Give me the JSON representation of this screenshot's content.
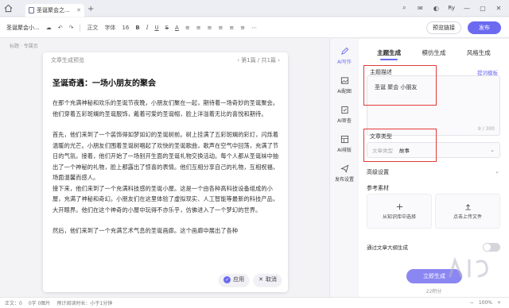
{
  "titlebar": {
    "tab_title": "圣诞聚会之...",
    "user_initials": "Ry",
    "controls": [
      "—",
      "▢",
      "✕"
    ]
  },
  "toolbar": {
    "doc_name": "圣诞聚会小...",
    "items": [
      "正文",
      "字体",
      "16",
      "B",
      "I",
      "U",
      "S",
      "A",
      "≡",
      "≡",
      "≡",
      "≡",
      "≡",
      "≡",
      "⋯"
    ],
    "preview_label": "预览链接",
    "publish_label": "发布"
  },
  "breadcrumb": "标题  · 专属页",
  "card": {
    "header": "文章生成预览",
    "pager": "‹ 第1篇 / 共1篇 ›",
    "title": "圣诞奇遇：一场小朋友的聚会",
    "paragraphs": [
      "在那个充满神秘和欢乐的圣诞节夜晚，小朋友们聚在一起，期待着一场奇妙的圣诞聚会。他们穿着五彩斑斓的圣诞服饰，戴着可爱的圣诞帽，脸上洋溢着无比的喜悦和期待。",
      "首先，他们来到了一个装饰得如梦如幻的圣诞树前。树上挂满了五彩斑斓的彩灯，闪烁着温暖的光芒。小朋友们围着圣诞树唱起了欢快的圣诞歌曲，歌声在空气中回荡，充满了节日的气氛。接着，他们开始了一场别开生面的圣诞礼物交换活动。每个人都从圣诞袜中抽出了一个神秘的礼物，脸上都露出了惊喜的表情。他们互相分享自己的礼物，互相祝福，场面温馨而感人。",
      "接下来，他们来到了一个充满科技感的圣诞小屋。这是一个由各种高科技设备组成的小屋，充满了神秘和奇幻。小朋友们在这里体验了虚拟现实、人工智能等最新的科技产品，大开眼界。他们在这个神奇的小屋中玩得不亦乐乎，仿佛进入了一个梦幻的世界。",
      "然后，他们来到了一个充满艺术气息的圣诞画廊。这个画廊中展出了各种"
    ],
    "apply_label": "应用",
    "cancel_label": "取消"
  },
  "rail": {
    "items": [
      "AI写作",
      "AI配图",
      "AI审查",
      "AI排版",
      "发布设置"
    ]
  },
  "panel": {
    "tabs": [
      "主题生成",
      "模仿生成",
      "风格生成"
    ],
    "topic_label": "主题描述",
    "template_link": "提词模板",
    "topic_value": "圣诞 聚会 小朋友",
    "counter": "9 / 300",
    "type_label": "文章类型",
    "type_key": "文章类型",
    "type_value": "故事",
    "advanced_label": "高级设置",
    "reference_label": "参考素材",
    "ref_buttons": [
      "从知识库中选择",
      "点击上传文件"
    ],
    "outline_label": "通过文章大纲生成",
    "generate_label": "立即生成",
    "credits": "22积分"
  },
  "statusbar": {
    "items": [
      "正文：0",
      "0字  0图片",
      "预计阅读时长：小于1分钟"
    ],
    "zoom": "100%"
  },
  "colors": {
    "accent": "#6b6af0",
    "highlight": "#e33a3a"
  }
}
